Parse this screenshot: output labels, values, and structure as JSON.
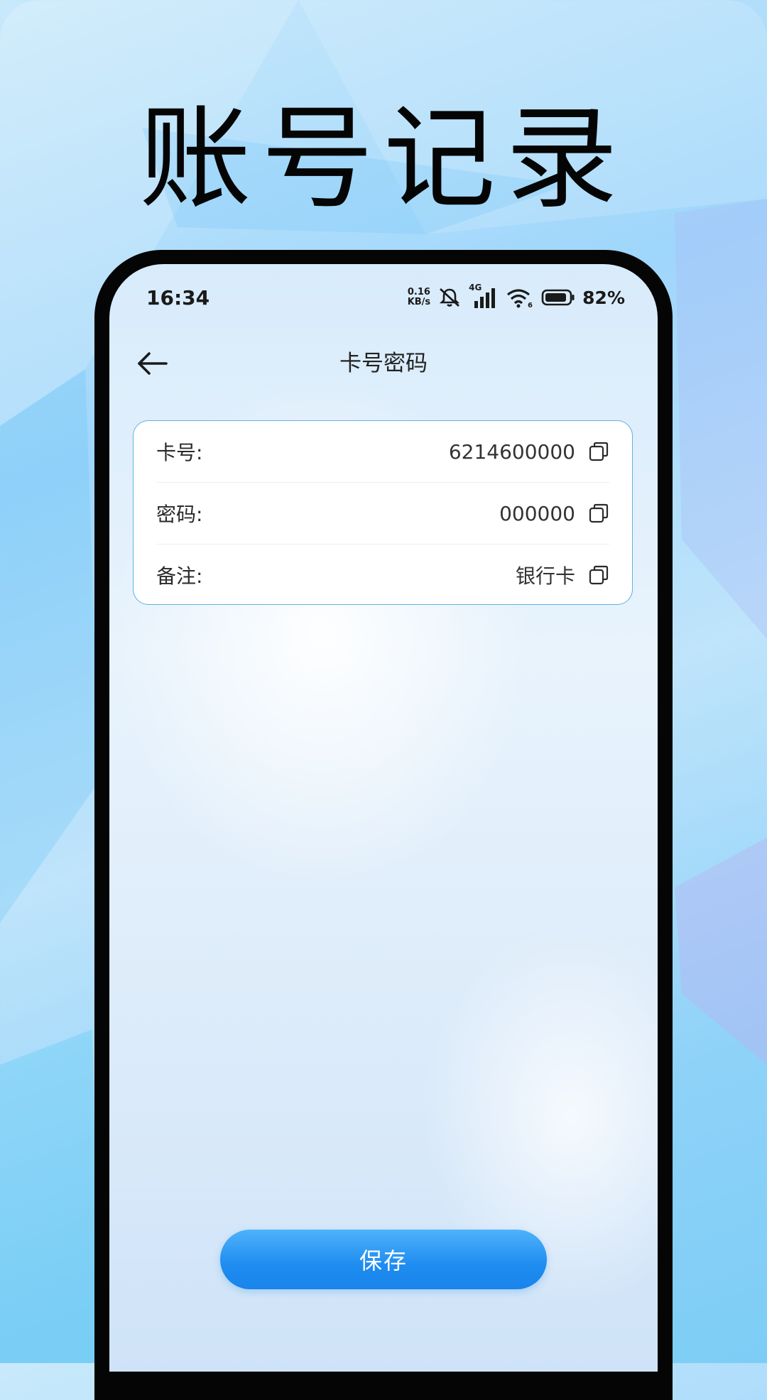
{
  "promo": {
    "headline": "账号记录"
  },
  "status_bar": {
    "time": "16:34",
    "net_speed_value": "0.16",
    "net_speed_unit": "KB/s",
    "network_type": "4G",
    "battery": "82%"
  },
  "header": {
    "title": "卡号密码",
    "back_icon": "arrow-left-icon"
  },
  "record": {
    "rows": [
      {
        "label": "卡号:",
        "value": "6214600000",
        "icon": "copy-icon"
      },
      {
        "label": "密码:",
        "value": "000000",
        "icon": "copy-icon"
      },
      {
        "label": "备注:",
        "value": "银行卡",
        "icon": "copy-icon"
      }
    ]
  },
  "actions": {
    "save_label": "保存"
  },
  "colors": {
    "accent": "#1e8cf0",
    "card_border": "#62b1e6",
    "headline": "#050505"
  }
}
